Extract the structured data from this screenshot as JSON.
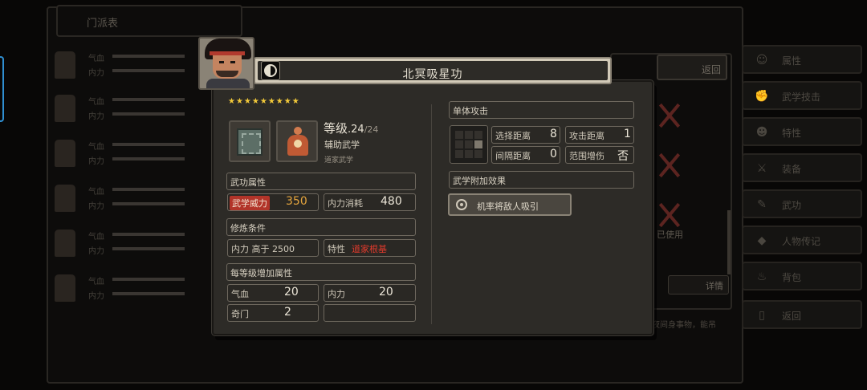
{
  "background": {
    "panel_title": "门派表",
    "top_return_label": "返回",
    "detail_label": "详情",
    "used_label": "已使用",
    "desc_fragment": "夜间身事物，能吊",
    "stat_labels": [
      "气血",
      "内力"
    ],
    "side_menu": [
      {
        "label": "属性",
        "icon": "person-icon"
      },
      {
        "label": "武学技击",
        "icon": "fist-icon"
      },
      {
        "label": "特性",
        "icon": "star-person-icon"
      },
      {
        "label": "装备",
        "icon": "sword-icon"
      },
      {
        "label": "武功",
        "icon": "scroll-icon"
      },
      {
        "label": "人物传记",
        "icon": "diamond-icon"
      },
      {
        "label": "背包",
        "icon": "bag-icon"
      },
      {
        "label": "返回",
        "icon": "door-icon"
      }
    ]
  },
  "modal": {
    "title": "北冥吸星功",
    "stars": "★★★★★★★★★",
    "level_prefix": "等级",
    "level_value": ".24",
    "level_max": "/24",
    "type": "辅助武学",
    "school": "道家武学",
    "sections": {
      "attributes": "武功属性",
      "requirements": "修炼条件",
      "per_level": "每等级增加属性",
      "single_attack": "单体攻击",
      "extra_effects": "武学附加效果"
    },
    "attributes": {
      "power_label": "武学威力",
      "power_value": "350",
      "cost_label": "内力消耗",
      "cost_value": "480"
    },
    "requirements": {
      "neili_req": "内力 高于 2500",
      "trait_label": "特性",
      "trait_value": "道家根基"
    },
    "per_level": {
      "hp_label": "气血",
      "hp_value": "20",
      "mp_label": "内力",
      "mp_value": "20",
      "qimen_label": "奇门",
      "qimen_value": "2"
    },
    "attack": {
      "select_range_label": "选择距离",
      "select_range_value": "8",
      "attack_range_label": "攻击距离",
      "attack_range_value": "1",
      "interval_label": "间隔距离",
      "interval_value": "0",
      "aoe_label": "范围增伤",
      "aoe_value": "否"
    },
    "effect_text": "机率将敌人吸引"
  },
  "colors": {
    "star": "#f2c93a",
    "power_highlight": "#b23429",
    "trait_red": "#e23a2c",
    "panel": "#2d2b27"
  }
}
